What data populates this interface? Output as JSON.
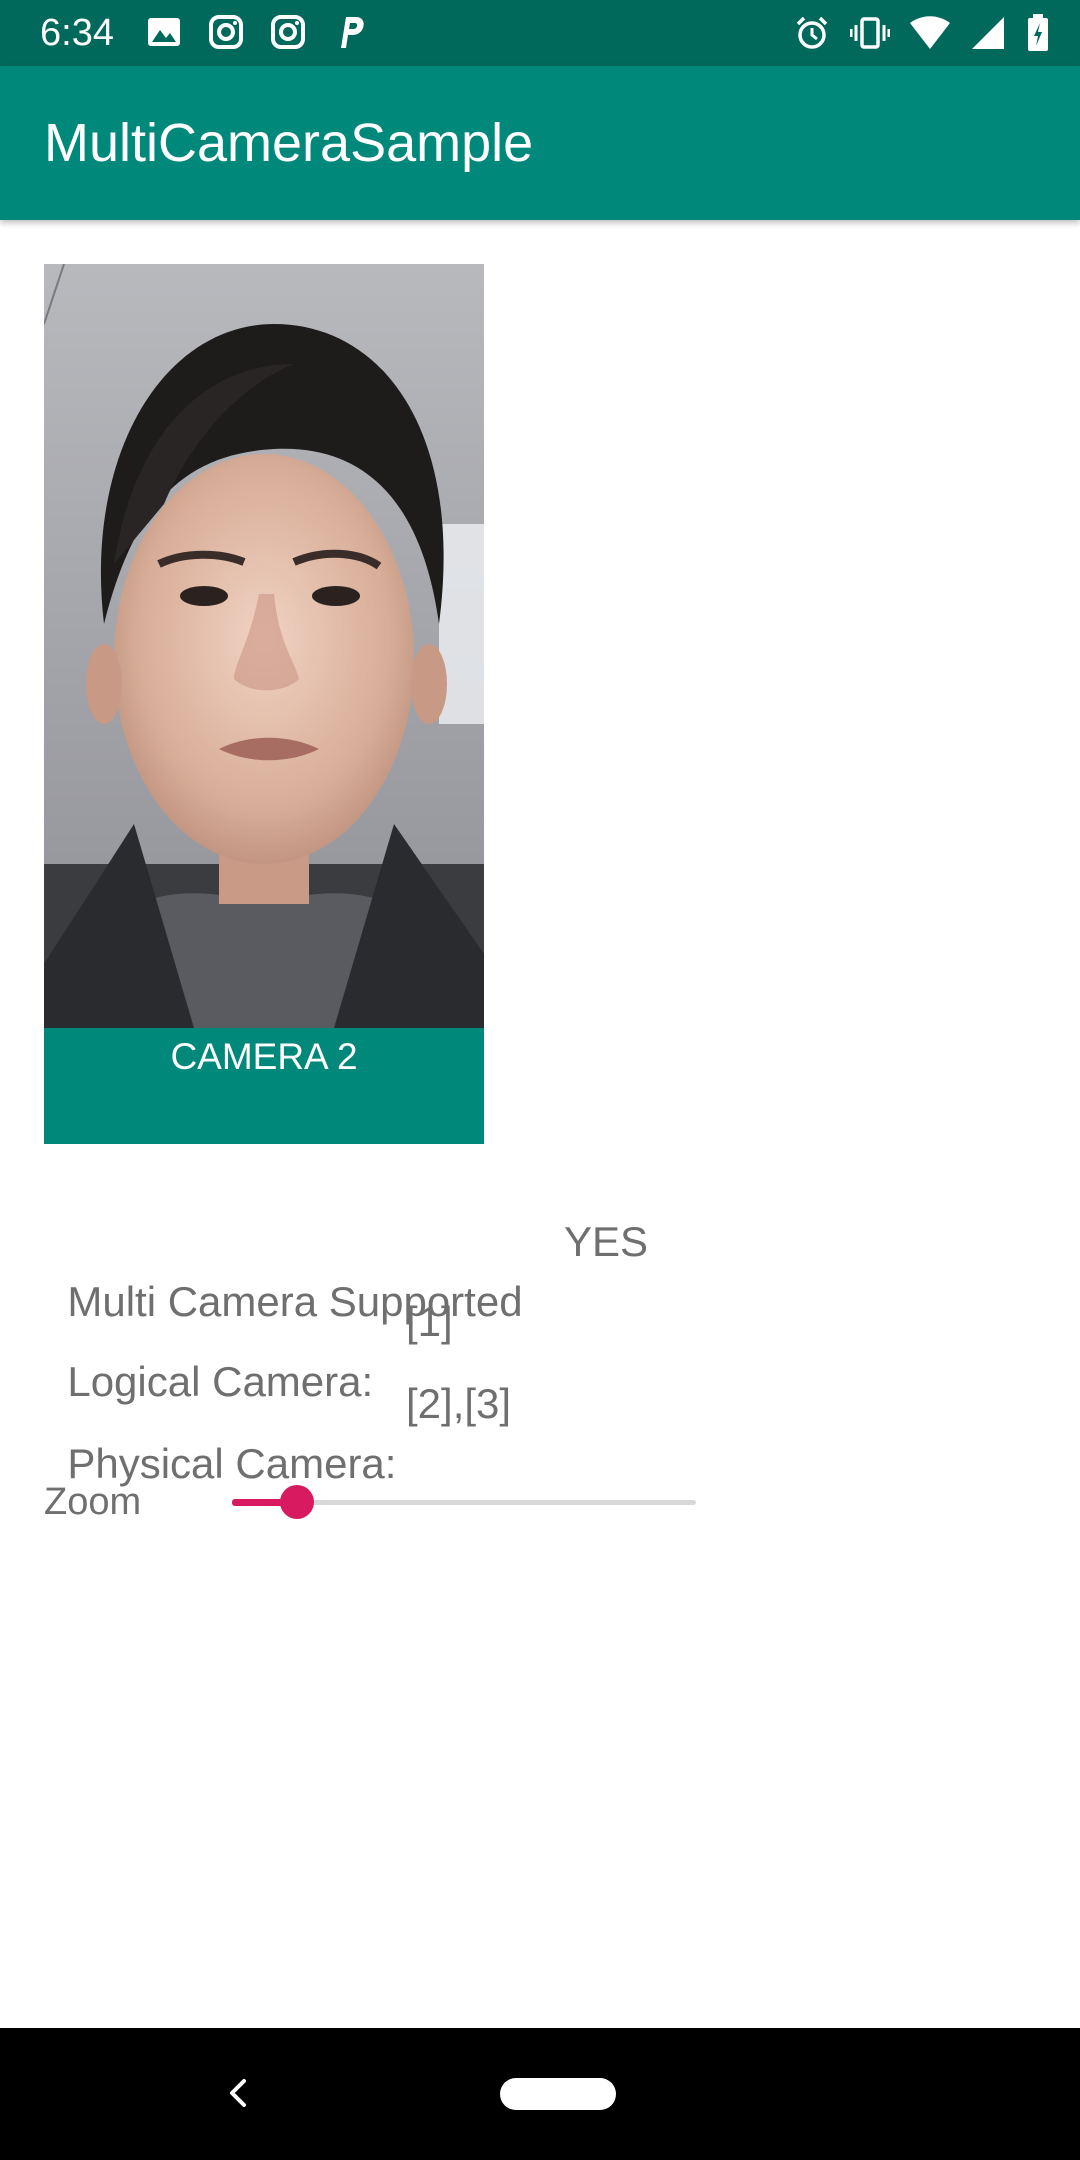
{
  "status_bar": {
    "time": "6:34",
    "left_icons": [
      "image-icon",
      "instagram-icon",
      "instagram-icon",
      "paypal-icon"
    ],
    "right_icons": [
      "alarm-icon",
      "vibrate-icon",
      "wifi-icon",
      "signal-icon",
      "battery-icon"
    ]
  },
  "app_bar": {
    "title": "MultiCameraSample"
  },
  "camera": {
    "button_label": "CAMERA 2"
  },
  "info": {
    "multi_label": "Multi Camera Supported",
    "multi_value": "YES",
    "logical_label": "Logical Camera:",
    "logical_value": "[1]",
    "physical_label": "Physical Camera:",
    "physical_value": "[2],[3]"
  },
  "zoom": {
    "label": "Zoom",
    "value_fraction": 0.14
  },
  "colors": {
    "primary_dark": "#00695c",
    "primary": "#00897b",
    "accent": "#d81b60"
  },
  "nav_bar": {
    "icons": [
      "back-icon",
      "home-pill"
    ]
  }
}
